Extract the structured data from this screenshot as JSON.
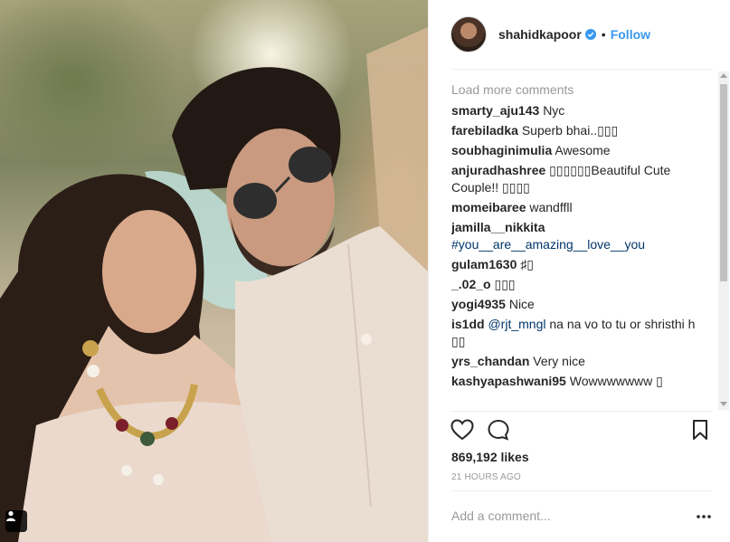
{
  "post": {
    "username": "shahidkapoor",
    "verified": true,
    "follow_label": "Follow",
    "separator": "•"
  },
  "comments": {
    "load_more": "Load more comments",
    "items": [
      {
        "user": "smarty_aju143",
        "text": "Nyc"
      },
      {
        "user": "farebiladka",
        "text": "Superb bhai..▯▯▯"
      },
      {
        "user": "soubhaginimulia",
        "text": "Awesome"
      },
      {
        "user": "anjuradhashree",
        "text": "▯▯▯▯▯▯Beautiful Cute Couple!! ▯▯▯▯"
      },
      {
        "user": "momeibaree",
        "text": "wandffll"
      },
      {
        "user": "jamilla__nikkita",
        "text": "#you__are__amazing__love__you",
        "is_tag": true
      },
      {
        "user": "gulam1630",
        "text": "♯▯"
      },
      {
        "user": "_.02_o",
        "text": "▯▯▯"
      },
      {
        "user": "yogi4935",
        "text": "Nice"
      },
      {
        "user": "is1dd",
        "mention": "@rjt_mngl",
        "text": " na na vo to tu or shristhi h ▯▯"
      },
      {
        "user": "yrs_chandan",
        "text": "Very nice"
      },
      {
        "user": "kashyapashwani95",
        "text": "Wowwwwwww ▯"
      }
    ]
  },
  "actions": {
    "like_icon": "heart-outline-icon",
    "comment_icon": "comment-bubble-icon",
    "save_icon": "bookmark-icon"
  },
  "likes_label": "869,192 likes",
  "timestamp": "21 HOURS AGO",
  "add_comment_placeholder": "Add a comment...",
  "more_icon": "ellipsis-icon",
  "colors": {
    "link": "#3897f0",
    "mention": "#003569",
    "muted": "#999999",
    "text": "#262626",
    "divider": "#efefef"
  }
}
